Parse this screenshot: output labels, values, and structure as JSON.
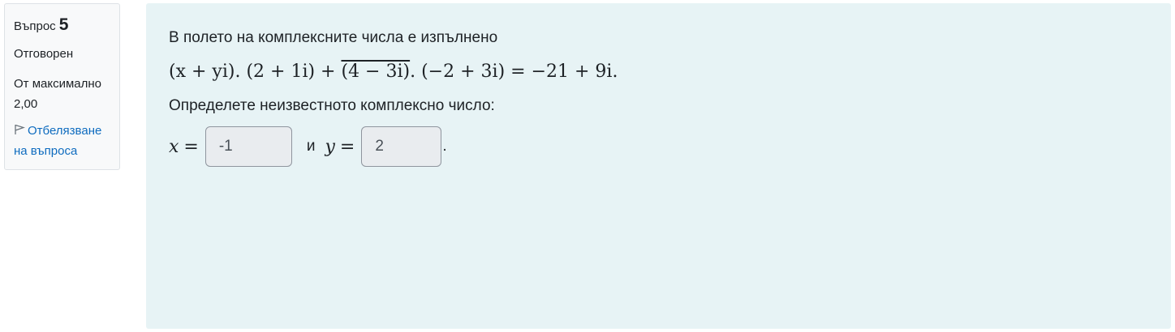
{
  "info": {
    "question_label": "Въпрос",
    "question_number": "5",
    "state": "Отговорен",
    "grade": "От максимално 2,00",
    "flag_label": "Отбелязване на въпроса"
  },
  "question": {
    "intro": "В полето на комплексните числа е изпълнено",
    "eq": {
      "lhs1": "(x + yi).",
      "lhs2": " (2 + 1i) + ",
      "conj": "(4 − 3i)",
      "lhs3": ". (−2 + 3i) = −21 + 9i."
    },
    "prompt": "Определете  неизвестното комплексно число:",
    "x_label": "x",
    "eq_sign": "=",
    "and_text": "и",
    "y_label": "y",
    "x_value": "-1",
    "y_value": "2",
    "end_dot": "."
  },
  "colors": {
    "content_bg": "#e7f3f5",
    "info_bg": "#f8f9fa",
    "link": "#0f6cbf",
    "input_bg": "#e9ecef"
  }
}
